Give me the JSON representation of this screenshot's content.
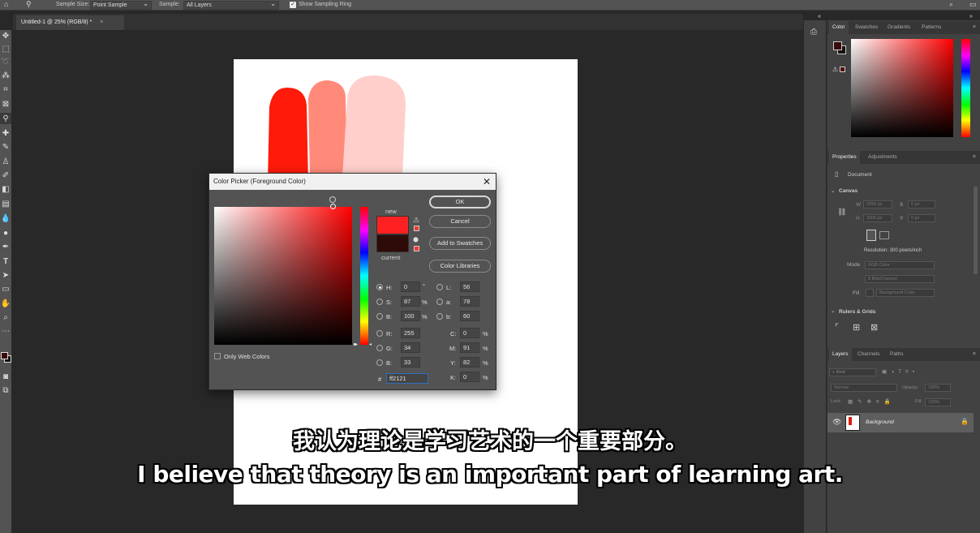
{
  "options_bar": {
    "sample_size_label": "Sample Size:",
    "sample_size_value": "Point Sample",
    "sample_label": "Sample:",
    "sample_value": "All Layers",
    "show_ring_label": "Show Sampling Ring"
  },
  "document_tab": {
    "title": "Untitled-1 @ 25% (RGB/8) *",
    "close": "×"
  },
  "color_picker": {
    "title": "Color Picker (Foreground Color)",
    "close": "✕",
    "new_label": "new",
    "current_label": "current",
    "new_color": "#ff2121",
    "current_color": "#2e0a08",
    "buttons": {
      "ok": "OK",
      "cancel": "Cancel",
      "add_to_swatches": "Add to Swatches",
      "color_libraries": "Color Libraries"
    },
    "only_web_colors": "Only Web Colors",
    "fields": {
      "H": {
        "label": "H:",
        "value": "0",
        "unit": "°"
      },
      "S": {
        "label": "S:",
        "value": "87",
        "unit": "%"
      },
      "B": {
        "label": "B:",
        "value": "100",
        "unit": "%"
      },
      "R": {
        "label": "R:",
        "value": "255"
      },
      "G": {
        "label": "G:",
        "value": "34"
      },
      "Bl": {
        "label": "B:",
        "value": "33"
      },
      "L": {
        "label": "L:",
        "value": "56"
      },
      "a": {
        "label": "a:",
        "value": "78"
      },
      "b": {
        "label": "b:",
        "value": "60"
      },
      "C": {
        "label": "C:",
        "value": "0",
        "unit": "%"
      },
      "M": {
        "label": "M:",
        "value": "91",
        "unit": "%"
      },
      "Y": {
        "label": "Y:",
        "value": "82",
        "unit": "%"
      },
      "K": {
        "label": "K:",
        "value": "0",
        "unit": "%"
      },
      "hex_label": "#",
      "hex": "ff2121"
    }
  },
  "color_panel": {
    "tabs": [
      "Color",
      "Swatches",
      "Gradients",
      "Patterns"
    ]
  },
  "properties_panel": {
    "tabs": [
      "Properties",
      "Adjustments"
    ],
    "document_label": "Document",
    "canvas_label": "Canvas",
    "w_label": "W",
    "w_value": "2550 px",
    "h_label": "H",
    "h_value": "3300 px",
    "x_label": "X",
    "x_value": "0 px",
    "y_label": "Y",
    "y_value": "0 px",
    "resolution": "Resolution: 300 pixels/inch",
    "mode_label": "Mode",
    "mode_value": "RGB Color",
    "depth_value": "8 Bits/Channel",
    "fill_label": "Fill",
    "fill_value": "Background Color",
    "rulers_label": "Rulers & Grids"
  },
  "layers_panel": {
    "tabs": [
      "Layers",
      "Channels",
      "Paths"
    ],
    "kind": "Kind",
    "blend_mode": "Normal",
    "opacity_label": "Opacity:",
    "opacity_value": "100%",
    "lock_label": "Lock:",
    "fill_label": "Fill:",
    "fill_value": "100%",
    "layer_name": "Background"
  },
  "subtitles": {
    "cn": "我认为理论是学习艺术的一个重要部分。",
    "en": "I believe that theory is an important part of learning art."
  }
}
